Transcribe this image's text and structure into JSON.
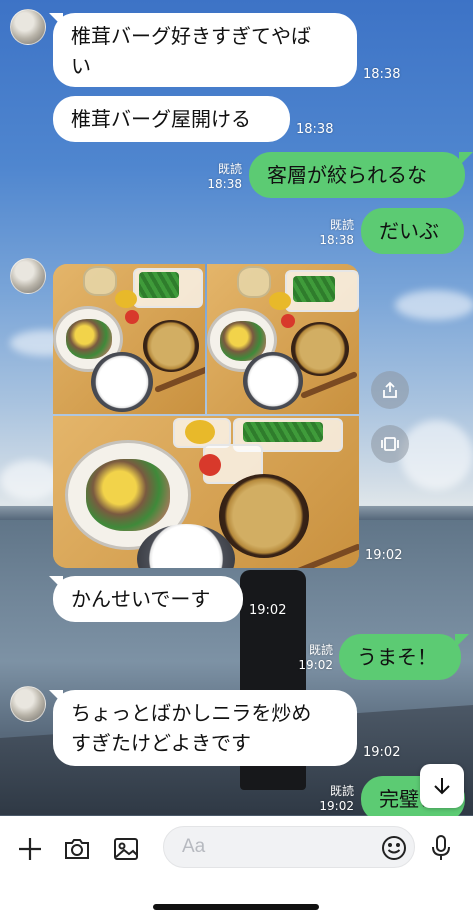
{
  "messages": [
    {
      "side": "in",
      "text_lines": [
        "椎茸バーグ好きすぎてやば",
        "い"
      ],
      "time": "18:38"
    },
    {
      "side": "in",
      "text": "椎茸バーグ屋開ける",
      "time": "18:38"
    },
    {
      "side": "out",
      "text": "客層が絞られるな",
      "read": "既読",
      "time": "18:38"
    },
    {
      "side": "out",
      "text": "だいぶ",
      "read": "既読",
      "time": "18:38"
    },
    {
      "side": "in",
      "type": "photo-collage",
      "time": "19:02"
    },
    {
      "side": "in",
      "text": "かんせいでーす",
      "time": "19:02"
    },
    {
      "side": "out",
      "text": "うまそ！",
      "read": "既読",
      "time": "19:02"
    },
    {
      "side": "in",
      "text_lines": [
        "ちょっとばかしニラを炒め",
        "すぎたけどよきです"
      ],
      "time": "19:02"
    },
    {
      "side": "out",
      "text": "完璧！",
      "read": "既読",
      "time": "19:02"
    }
  ],
  "input": {
    "placeholder": "Aa",
    "icons": [
      "plus-icon",
      "camera-icon",
      "image-icon",
      "emoji-icon",
      "microphone-icon"
    ]
  },
  "side_buttons": [
    "share-icon",
    "gallery-icon"
  ],
  "colors": {
    "outgoing_bubble": "#5ccb73",
    "incoming_bubble": "#ffffff"
  }
}
